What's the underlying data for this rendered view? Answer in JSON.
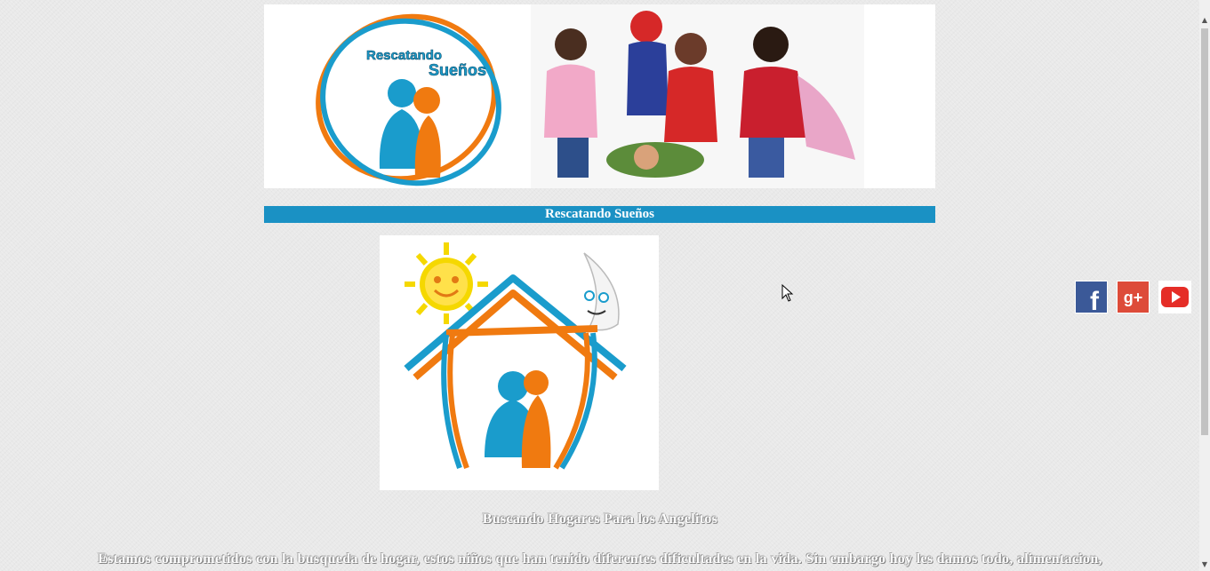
{
  "site": {
    "banner_logo_text_line1": "Rescatando",
    "banner_logo_text_line2": "Sueños",
    "title": "Rescatando Sueños"
  },
  "social": [
    {
      "name": "facebook",
      "glyph": "f",
      "color": "#3b5998"
    },
    {
      "name": "google-plus",
      "glyph": "g+",
      "color": "#dd4b39"
    },
    {
      "name": "youtube",
      "glyph": "▶",
      "color": "#e52d27"
    }
  ],
  "content": {
    "subheading": "Buscando Hogares Para los Angelitos",
    "paragraph": "Estamos comprometidos con la busqueda de hogar, estos niños que han tenido diferentes dificultades en la vida. Sin embargo hoy les damos todo, alimentacion,"
  },
  "colors": {
    "accent": "#1a91c4",
    "orange": "#f07a10",
    "blue": "#1a9ccc",
    "sun": "#f5d800"
  }
}
